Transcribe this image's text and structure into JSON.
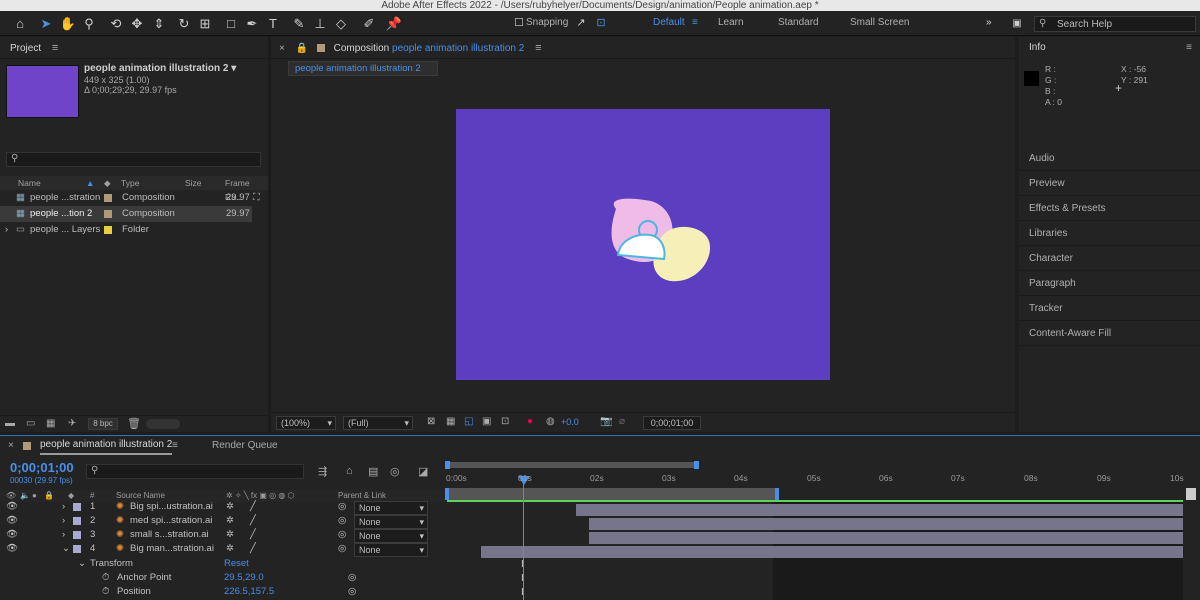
{
  "window": {
    "title": "Adobe After Effects 2022 - /Users/rubyhelyer/Documents/Design/animation/People animation.aep *"
  },
  "toolbar": {
    "snapping_label": "Snapping",
    "workspaces": [
      "Default",
      "Learn",
      "Standard",
      "Small Screen"
    ],
    "active_workspace": "Default",
    "search_placeholder": "Search Help"
  },
  "project": {
    "panel_title": "Project",
    "item_name": "people animation illustration 2",
    "item_dims": "449 x 325 (1.00)",
    "item_duration": "Δ 0;00;29;29, 29.97 fps",
    "columns": [
      "Name",
      "Type",
      "Size",
      "Frame Ra..."
    ],
    "rows": [
      {
        "name": "people ...stration",
        "type": "Composition",
        "fps": "29.97",
        "color": "#b09a7a"
      },
      {
        "name": "people ...tion 2",
        "type": "Composition",
        "fps": "29.97",
        "color": "#b09a7a"
      },
      {
        "name": "people ... Layers",
        "type": "Folder",
        "fps": "",
        "color": "#e6d040"
      }
    ],
    "bpc": "8 bpc"
  },
  "composition": {
    "panel_label": "Composition",
    "comp_name": "people animation illustration 2",
    "tab_label": "people animation illustration 2",
    "bg_color": "#5b3fc0",
    "zoom": "(100%)",
    "quality": "(Full)",
    "exposure": "+0.0",
    "timecode": "0;00;01;00"
  },
  "info": {
    "panel_title": "Info",
    "r": "R :",
    "g": "G :",
    "b": "B :",
    "a": "A :  0",
    "x": "X : -56",
    "y": "Y : 291",
    "panels": [
      "Audio",
      "Preview",
      "Effects & Presets",
      "Libraries",
      "Character",
      "Paragraph",
      "Tracker",
      "Content-Aware Fill"
    ]
  },
  "timeline": {
    "tab_label": "people animation illustration 2",
    "render_queue_label": "Render Queue",
    "current_time": "0;00;01;00",
    "frames": "00030 (29.97 fps)",
    "col_source": "Source Name",
    "col_parent": "Parent & Link",
    "ruler": [
      "0:00s",
      "01s",
      "02s",
      "03s",
      "04s",
      "05s",
      "06s",
      "07s",
      "08s",
      "09s",
      "10s"
    ],
    "layers": [
      {
        "num": "1",
        "name": "Big spi...ustration.ai",
        "parent": "None"
      },
      {
        "num": "2",
        "name": "med spi...stration.ai",
        "parent": "None"
      },
      {
        "num": "3",
        "name": "small s...stration.ai",
        "parent": "None"
      },
      {
        "num": "4",
        "name": "Big man...stration.ai",
        "parent": "None"
      }
    ],
    "transform_label": "Transform",
    "reset_label": "Reset",
    "anchor_label": "Anchor Point",
    "anchor_value": "29.5,29.0",
    "position_label": "Position",
    "position_value": "226.5,157.5"
  },
  "colors": {
    "accent": "#4a8fe7",
    "layer_label": "#a9a9d6",
    "work_area_green": "#5fd35a"
  }
}
